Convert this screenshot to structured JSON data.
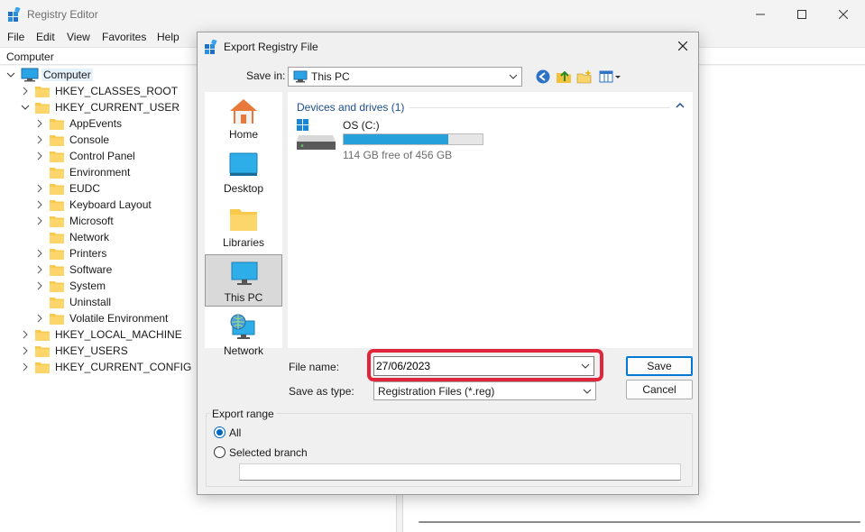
{
  "window": {
    "title": "Registry Editor",
    "address": "Computer",
    "menu": [
      "File",
      "Edit",
      "View",
      "Favorites",
      "Help"
    ]
  },
  "tree": {
    "root": "Computer",
    "hives": [
      "HKEY_CLASSES_ROOT",
      "HKEY_CURRENT_USER",
      "HKEY_LOCAL_MACHINE",
      "HKEY_USERS",
      "HKEY_CURRENT_CONFIG"
    ],
    "current_user_children": [
      "AppEvents",
      "Console",
      "Control Panel",
      "Environment",
      "EUDC",
      "Keyboard Layout",
      "Microsoft",
      "Network",
      "Printers",
      "Software",
      "System",
      "Uninstall",
      "Volatile Environment"
    ]
  },
  "dialog": {
    "title": "Export Registry File",
    "save_in_label": "Save in:",
    "save_in_value": "This PC",
    "places": [
      "Home",
      "Desktop",
      "Libraries",
      "This PC",
      "Network"
    ],
    "selected_place": "This PC",
    "group_header": "Devices and drives (1)",
    "drive": {
      "name": "OS (C:)",
      "free_text": "114 GB free of 456 GB",
      "used_fraction": 0.75
    },
    "file_name_label": "File name:",
    "file_name_value": "27/06/2023",
    "save_as_type_label": "Save as type:",
    "save_as_type_value": "Registration Files (*.reg)",
    "save_button": "Save",
    "cancel_button": "Cancel",
    "export_range": {
      "legend": "Export range",
      "all_label": "All",
      "branch_label": "Selected branch",
      "selected": "All",
      "branch_value": ""
    }
  },
  "colors": {
    "accent": "#0078d4",
    "highlight_border": "#e0263a",
    "drive_fill": "#26a0da",
    "folder": "#f8c94a",
    "group_header": "#1e4e8c"
  }
}
